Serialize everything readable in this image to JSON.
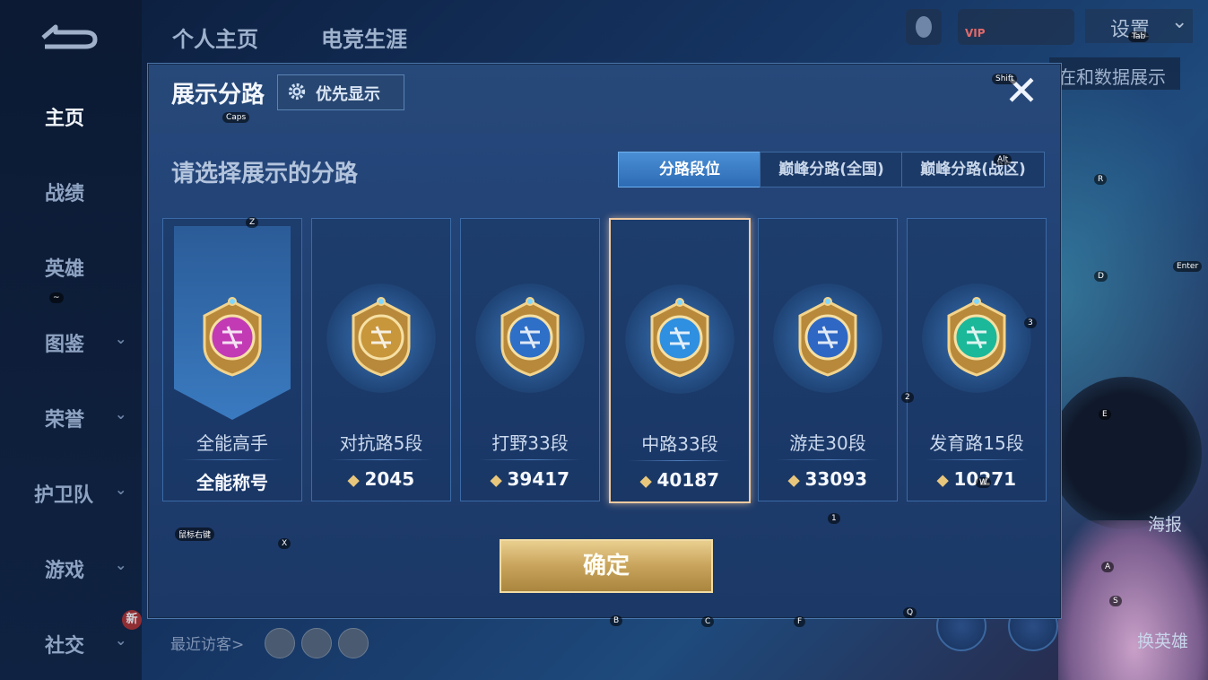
{
  "sidebar": {
    "back_icon": "back-arrow-icon",
    "items": [
      {
        "label": "主页",
        "has_chevron": false
      },
      {
        "label": "战绩",
        "has_chevron": false
      },
      {
        "label": "英雄",
        "has_chevron": false
      },
      {
        "label": "图鉴",
        "has_chevron": true
      },
      {
        "label": "荣誉",
        "has_chevron": true
      },
      {
        "label": "护卫队",
        "has_chevron": true
      },
      {
        "label": "游戏",
        "has_chevron": true
      },
      {
        "label": "社交",
        "has_chevron": true
      }
    ],
    "new_badge": "新",
    "chevron": "⌄"
  },
  "header": {
    "tabs": [
      "个人主页",
      "电竞生涯"
    ],
    "settings_label": "设置",
    "settings_chevron": "⌄",
    "behind_text": "在和数据展示",
    "vip_label": "VIP"
  },
  "background": {
    "recent_visitors": "最近访客>",
    "poster_label": "海报",
    "swap_hero_label": "换英雄"
  },
  "modal": {
    "title": "展示分路",
    "priority_label": "优先显示",
    "close_symbol": "✕",
    "subtitle": "请选择展示的分路",
    "segments": [
      {
        "label": "分路段位",
        "active": true
      },
      {
        "label": "巅峰分路(全国)",
        "active": false
      },
      {
        "label": "巅峰分路(战区)",
        "active": false
      }
    ],
    "cards": [
      {
        "name": "全能高手",
        "value": "全能称号",
        "has_points_icon": false,
        "selected": false,
        "emblem_color": "#c23bb5"
      },
      {
        "name": "对抗路5段",
        "value": "2045",
        "has_points_icon": true,
        "selected": false,
        "emblem_color": "#c8963b"
      },
      {
        "name": "打野33段",
        "value": "39417",
        "has_points_icon": true,
        "selected": false,
        "emblem_color": "#2e6fc8"
      },
      {
        "name": "中路33段",
        "value": "40187",
        "has_points_icon": true,
        "selected": true,
        "emblem_color": "#2f8fe0"
      },
      {
        "name": "游走30段",
        "value": "33093",
        "has_points_icon": true,
        "selected": false,
        "emblem_color": "#2f67c4"
      },
      {
        "name": "发育路15段",
        "value": "10271",
        "has_points_icon": true,
        "selected": false,
        "emblem_color": "#1bb89a"
      }
    ],
    "confirm_label": "确定"
  },
  "key_hints": [
    "Caps",
    "Z",
    "~",
    "X",
    "鼠标右键",
    "Shift",
    "Alt",
    "Tab",
    "R",
    "D",
    "Enter",
    "3",
    "2",
    "E",
    "1",
    "W",
    "A",
    "S",
    "B",
    "C",
    "F",
    "Q"
  ],
  "colors": {
    "accent_blue": "#2d6bb4",
    "gold": "#c8a35b",
    "selected_border": "#f0c9a0"
  }
}
